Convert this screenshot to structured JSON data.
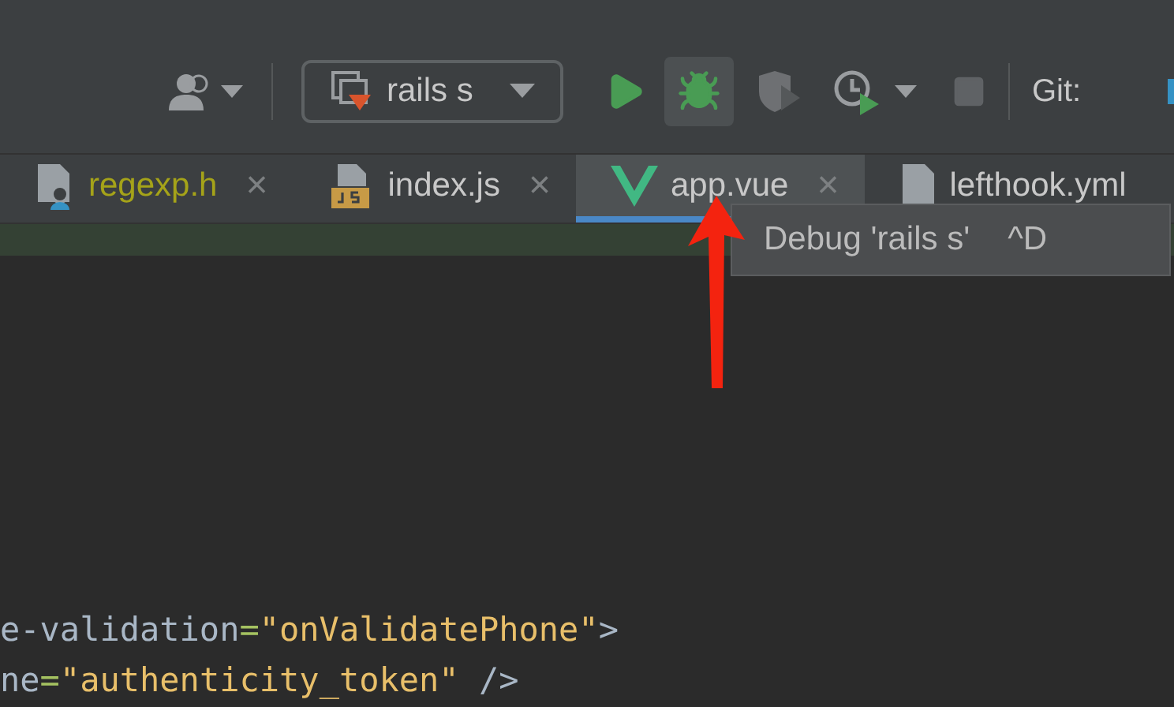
{
  "toolbar": {
    "run_config": "rails s",
    "git_label": "Git:",
    "debug_highlighted": true
  },
  "tabs": [
    {
      "label": "regexp.h",
      "kind": "header",
      "selected": false,
      "close": "×"
    },
    {
      "label": "index.js",
      "kind": "js",
      "selected": false,
      "close": "×"
    },
    {
      "label": "app.vue",
      "kind": "vue",
      "selected": true,
      "close": "×"
    },
    {
      "label": "lefthook.yml",
      "kind": "file",
      "selected": false
    }
  ],
  "tooltip": {
    "text": "Debug 'rails s'",
    "shortcut": "^D"
  },
  "code_lines": [
    [
      {
        "text": "e-validation",
        "kind": "attr"
      },
      {
        "text": "=",
        "kind": "op"
      },
      {
        "text": "\"onValidatePhone\"",
        "kind": "string"
      },
      {
        "text": ">",
        "kind": "attr"
      }
    ],
    [
      {
        "text": "ne",
        "kind": "attr"
      },
      {
        "text": "=",
        "kind": "op"
      },
      {
        "text": "\"authenticity_token\"",
        "kind": "string"
      },
      {
        "text": " />",
        "kind": "attr"
      }
    ]
  ]
}
